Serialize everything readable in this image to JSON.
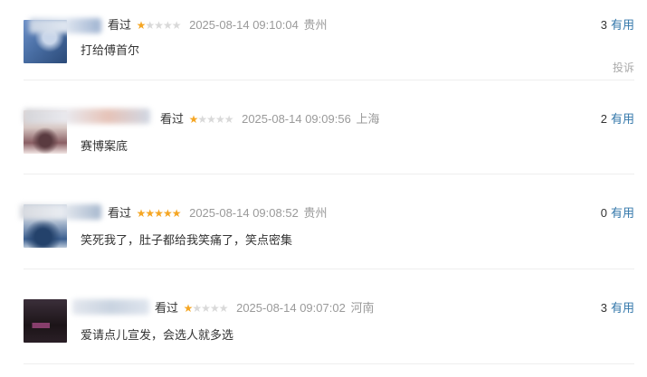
{
  "reviews": [
    {
      "status": "看过",
      "rating": 1,
      "time": "2025-08-14 09:10:04",
      "location": "贵州",
      "comment": "打给傅首尔",
      "votes": "3",
      "useful_label": "有用",
      "report_label": "投诉",
      "avatar_colors": [
        "#4a6fa5",
        "#6c8fc7",
        "#2b4a78"
      ],
      "name_tail": "#9fb3d1"
    },
    {
      "status": "看过",
      "rating": 1,
      "time": "2025-08-14 09:09:56",
      "location": "上海",
      "comment": "赛博案底",
      "votes": "2",
      "useful_label": "有用",
      "avatar_colors": [
        "#d7c7c3",
        "#8a5f64",
        "#f2e6e4"
      ],
      "name_tail": "#e6c3b8"
    },
    {
      "status": "看过",
      "rating": 5,
      "time": "2025-08-14 09:08:52",
      "location": "贵州",
      "comment": "笑死我了，肚子都给我笑痛了，笑点密集",
      "votes": "0",
      "useful_label": "有用",
      "avatar_colors": [
        "#9fb1c9",
        "#3c5f8f",
        "#b9c8d9"
      ],
      "name_tail": "#a7b8ce"
    },
    {
      "status": "看过",
      "rating": 1,
      "time": "2025-08-14 09:07:02",
      "location": "河南",
      "comment": "爱请点儿宣发，会选人就多选",
      "votes": "3",
      "useful_label": "有用",
      "avatar_colors": [
        "#3b2f3a",
        "#1c1418",
        "#7a4f6f"
      ],
      "name_tail": "#c9d3e0"
    }
  ],
  "colors": {
    "star_on": "#f5a623",
    "star_off": "#d9d9d9",
    "link": "#3377aa",
    "muted": "#9a9a9a"
  }
}
